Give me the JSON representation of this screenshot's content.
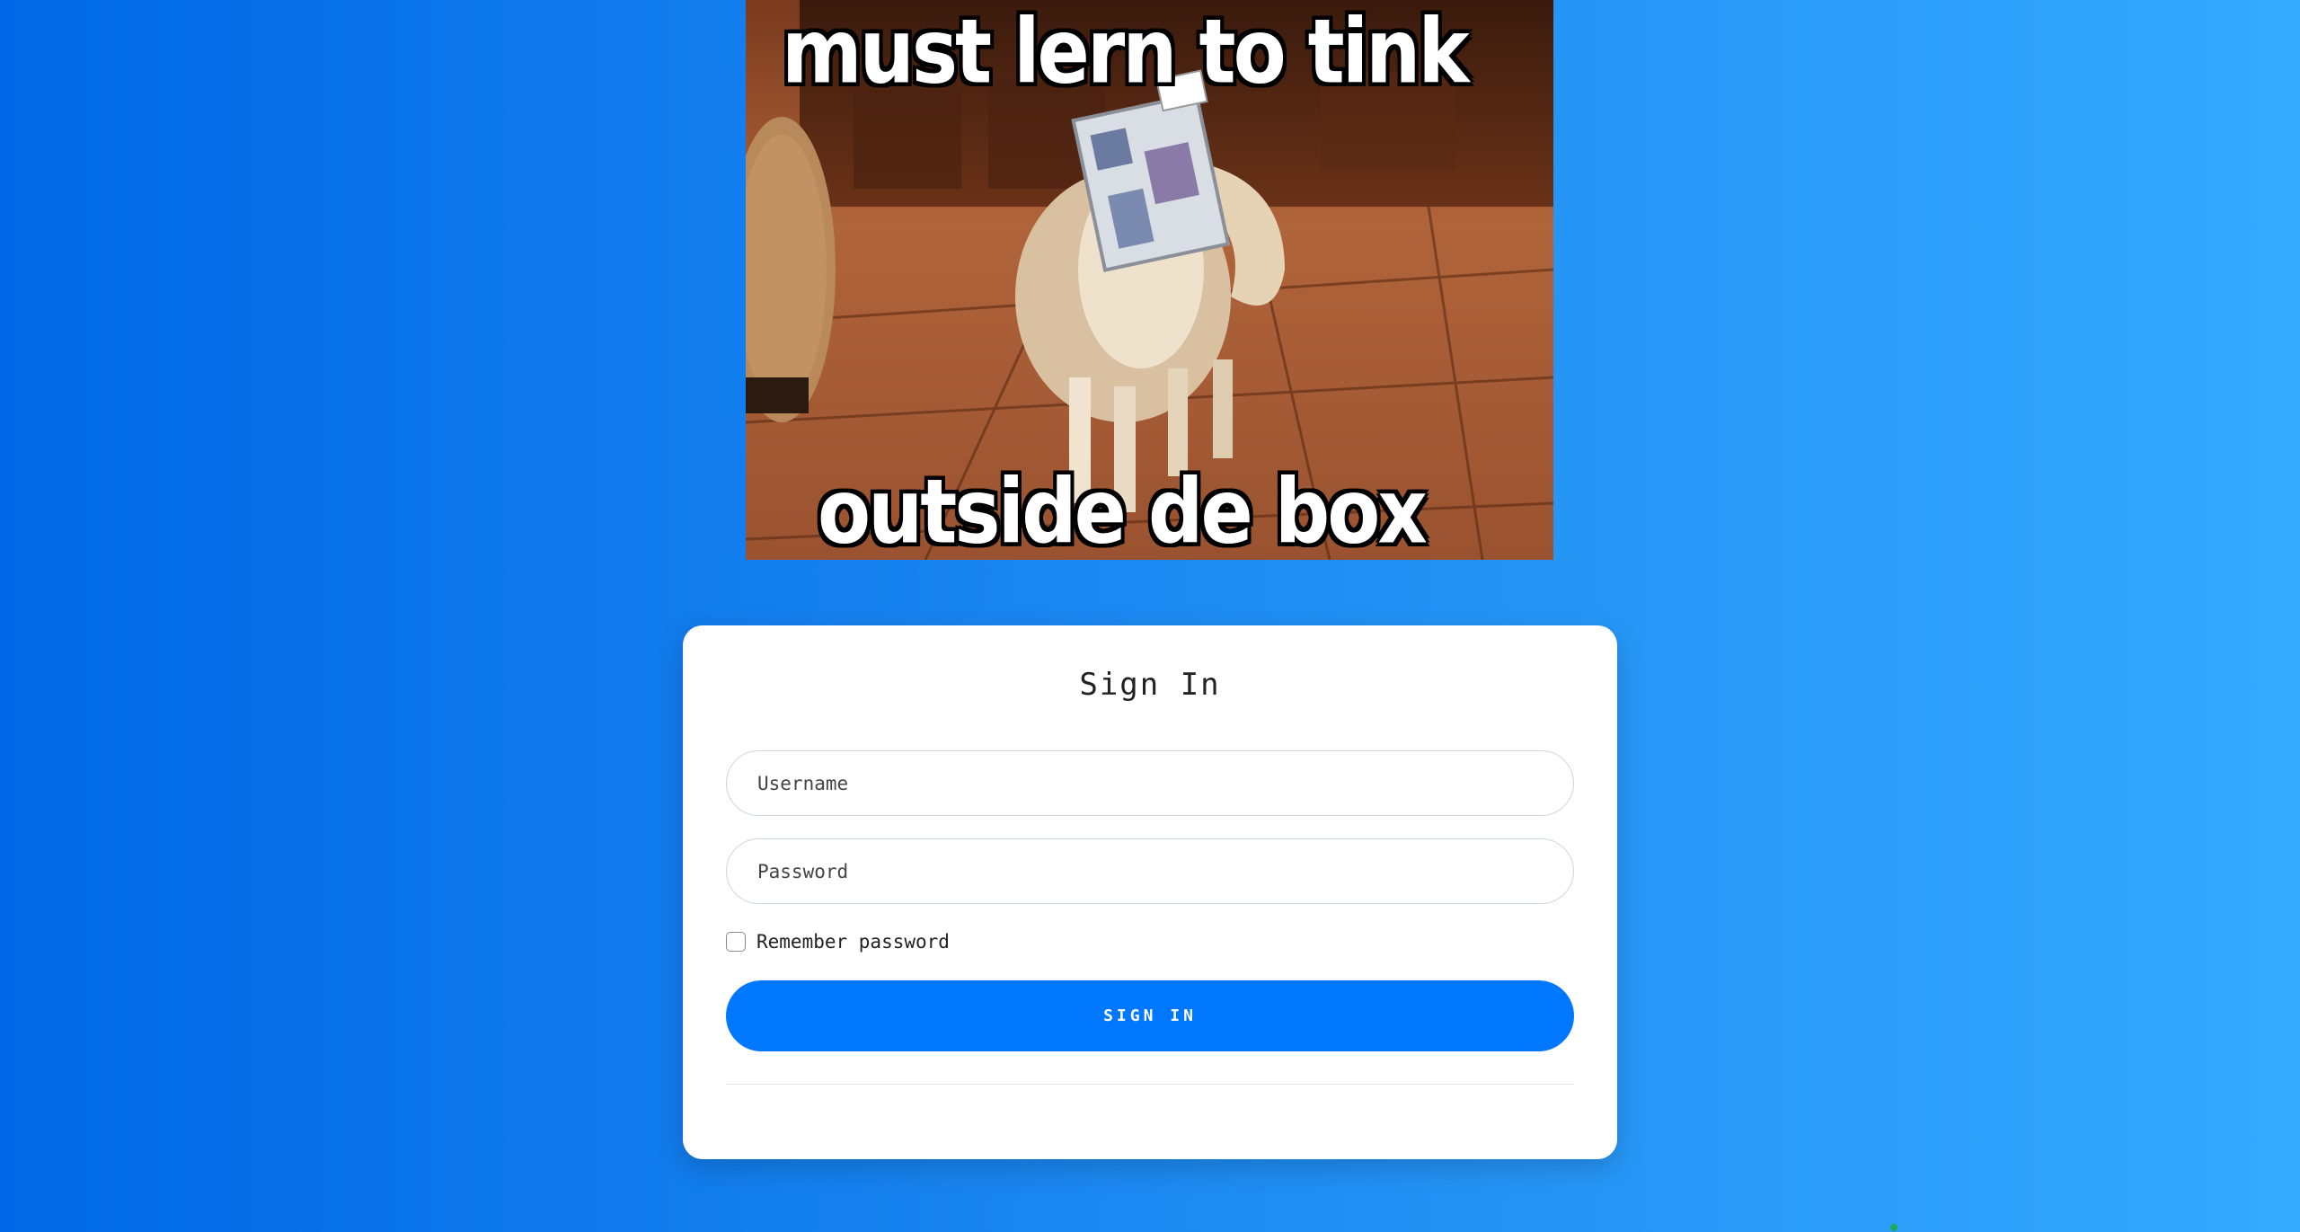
{
  "meme": {
    "top_caption": "must lern to tink",
    "bottom_caption": "outside de box"
  },
  "signin": {
    "title": "Sign In",
    "username_placeholder": "Username",
    "password_placeholder": "Password",
    "remember_label": "Remember password",
    "button_label": "SIGN IN"
  },
  "colors": {
    "accent": "#0077ff",
    "background_start": "#0068e6",
    "background_end": "#35aaff"
  }
}
